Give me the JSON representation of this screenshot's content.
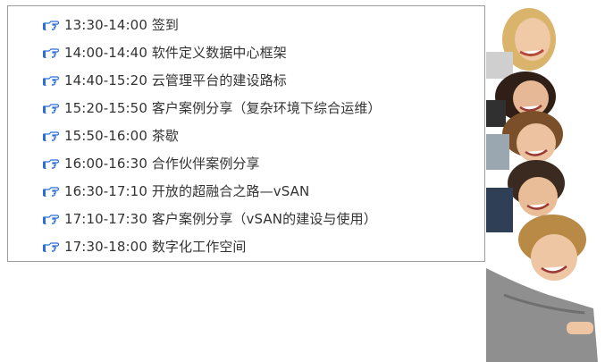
{
  "agenda": {
    "items": [
      {
        "text": "13:30-14:00 签到"
      },
      {
        "text": "14:00-14:40 软件定义数据中心框架"
      },
      {
        "text": "14:40-15:20 云管理平台的建设路标"
      },
      {
        "text": "15:20-15:50 客户案例分享（复杂环境下综合运维）"
      },
      {
        "text": "15:50-16:00 茶歇"
      },
      {
        "text": "16:00-16:30 合作伙伴案例分享"
      },
      {
        "text": "16:30-17:10 开放的超融合之路—vSAN"
      },
      {
        "text": "17:10-17:30 客户案例分享（vSAN的建设与使用）"
      },
      {
        "text": "17:30-18:00 数字化工作空间"
      }
    ],
    "bullet_icon": "pointing-hand-icon",
    "bullet_color": "#2b6fd6",
    "text_color": "#333333",
    "border_color": "#9c9c9c"
  },
  "photo": {
    "subject": "group-of-smiling-teenagers",
    "icon": "people-photo"
  }
}
